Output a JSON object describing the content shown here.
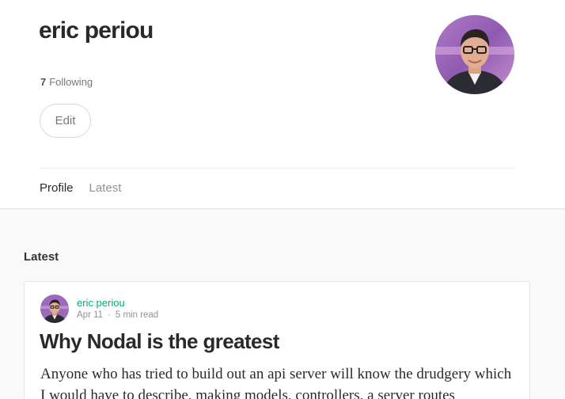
{
  "profile": {
    "name": "eric periou",
    "following_count": "7",
    "following_label": "Following",
    "edit_label": "Edit"
  },
  "tabs": [
    {
      "label": "Profile",
      "active": true
    },
    {
      "label": "Latest",
      "active": false
    }
  ],
  "section": {
    "title": "Latest"
  },
  "post": {
    "author": "eric periou",
    "date": "Apr 11",
    "read_time": "5 min read",
    "title": "Why Nodal is the greatest",
    "excerpt": "Anyone who has tried to build out an api server will know the drudgery which I would have to describe, making models, controllers, a server routes"
  },
  "colors": {
    "accent": "#03a87c",
    "background": "#fafafa"
  }
}
